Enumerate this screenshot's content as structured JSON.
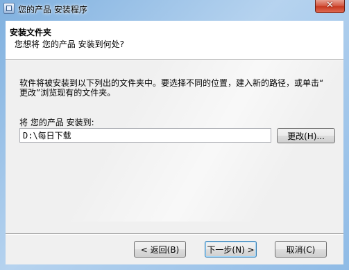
{
  "window": {
    "title": "您的产品 安装程序",
    "close_label": "✕"
  },
  "header": {
    "title": "安装文件夹",
    "subtitle": "您想将 您的产品 安装到何处?"
  },
  "body": {
    "description_line1": "软件将被安装到以下列出的文件夹中。要选择不同的位置，建入新的路径，或单击“",
    "description_line2": "更改”浏览现有的文件夹。",
    "folder_label": "将 您的产品 安装到:",
    "install_path": "D:\\每日下载",
    "browse_label": "更改(H)..."
  },
  "buttons": {
    "back_label": "< 返回(B)",
    "next_label": "下一步(N) >",
    "cancel_label": "取消(C)"
  }
}
